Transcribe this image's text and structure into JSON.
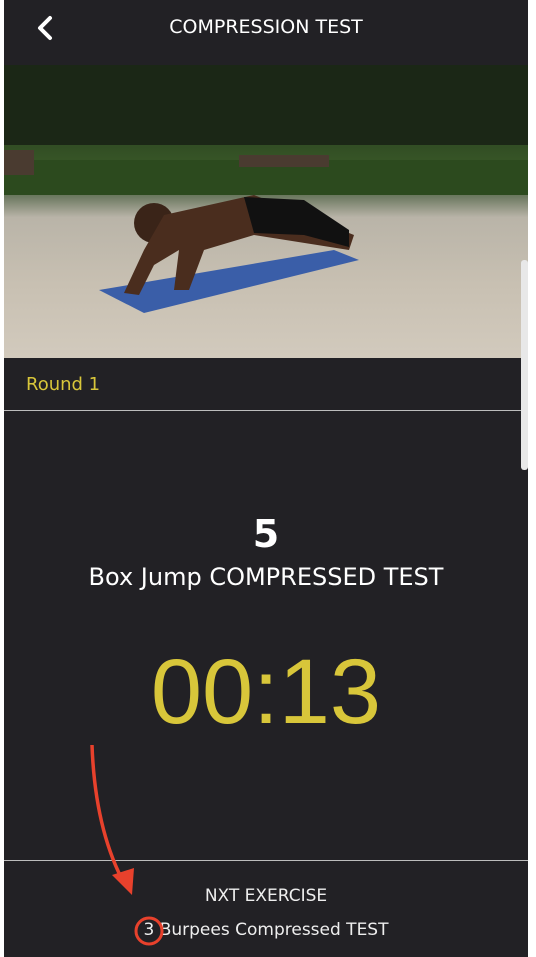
{
  "header": {
    "title": "COMPRESSION TEST",
    "back_icon": "chevron-left-icon"
  },
  "video": {
    "description_icon": "exercise-video"
  },
  "round": {
    "label": "Round 1"
  },
  "current": {
    "reps": "5",
    "name": "Box Jump COMPRESSED TEST"
  },
  "timer": {
    "value": "00:13"
  },
  "next": {
    "label": "NXT EXERCISE",
    "name": "3 Burpees Compressed TEST"
  },
  "colors": {
    "background": "#222125",
    "accent": "#d8c63a",
    "annotation": "#e8412c"
  }
}
